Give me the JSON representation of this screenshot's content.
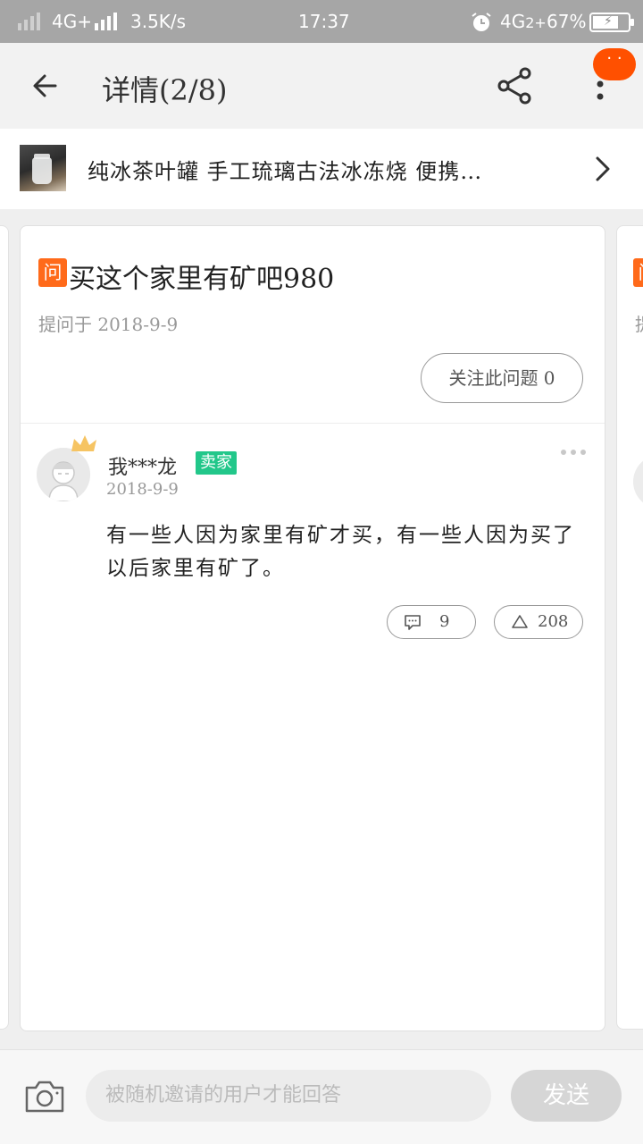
{
  "status_bar": {
    "network1": "4G+",
    "speed": "3.5K/s",
    "time": "17:37",
    "network2": "4G",
    "network2_suffix": "2+",
    "battery": "67%"
  },
  "header": {
    "title": "详情(2/8)",
    "badge": "· ·"
  },
  "product": {
    "name": "纯冰茶叶罐 手工琉璃古法冰冻烧 便携…"
  },
  "question": {
    "tag": "问",
    "title": "买这个家里有矿吧980",
    "asked": "提问于 2018-9-9",
    "follow_label": "关注此问题 0"
  },
  "answer": {
    "user": "我***龙",
    "seller_tag": "卖家",
    "date": "2018-9-9",
    "body": "有一些人因为家里有矿才买，有一些人因为买了以后家里有矿了。",
    "comments": "9",
    "votes": "208"
  },
  "side_card_right": {
    "tag": "问",
    "date_fragment": "提"
  },
  "bottom": {
    "placeholder": "被随机邀请的用户才能回答",
    "send_label": "发送"
  },
  "colors": {
    "accent": "#ff5000",
    "question_tag": "#ff6a1a",
    "seller_tag": "#22c78a"
  }
}
